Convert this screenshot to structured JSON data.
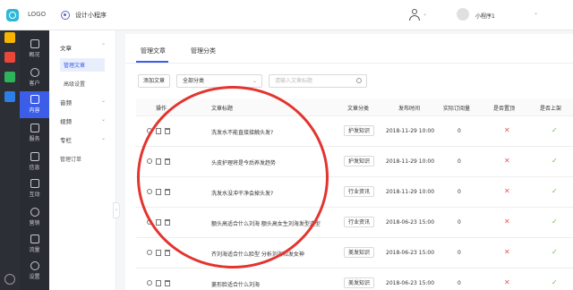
{
  "header": {
    "logo": "LOGO",
    "app_name": "设计小程序",
    "account_name": "小程序1"
  },
  "nav": {
    "items": [
      {
        "label": "概况"
      },
      {
        "label": "客户"
      },
      {
        "label": "内容",
        "active": true
      },
      {
        "label": "服务"
      },
      {
        "label": "信息"
      },
      {
        "label": "互动"
      },
      {
        "label": "营销"
      },
      {
        "label": "流量"
      },
      {
        "label": "设置"
      }
    ]
  },
  "submenu": {
    "group_article": "文章",
    "item_manage": "管理文章",
    "item_advanced": "高级设置",
    "group_audio": "音频",
    "group_video": "视频",
    "group_column": "专栏",
    "item_orders": "管理订单"
  },
  "tabs": [
    "管理文章",
    "管理分类"
  ],
  "toolbar": {
    "add_label": "添加文章",
    "category_value": "全部分类",
    "search_placeholder": "请输入文章标题"
  },
  "table": {
    "columns": [
      "操作",
      "文章标题",
      "文章分类",
      "发布时间",
      "实际订阅量",
      "是否置顶",
      "是否上架"
    ],
    "rows": [
      {
        "title": "洗发水不能直接接触头发?",
        "category": "护发知识",
        "date": "2018-11-29 10:00",
        "subs": "0",
        "pinned": false,
        "listed": true
      },
      {
        "title": "头皮护理将是今后养发趋势",
        "category": "护发知识",
        "date": "2018-11-29 10:00",
        "subs": "0",
        "pinned": false,
        "listed": true
      },
      {
        "title": "洗发水没冲干净会掉头发?",
        "category": "行业资讯",
        "date": "2018-11-29 10:00",
        "subs": "0",
        "pinned": false,
        "listed": true
      },
      {
        "title": "额头高适合什么刘海 额头高女生刘海发型造型",
        "category": "行业资讯",
        "date": "2018-06-23 15:00",
        "subs": "0",
        "pinned": false,
        "listed": true
      },
      {
        "title": "齐刘海适合什么脸型 分析刘海和发女神",
        "category": "美发知识",
        "date": "2018-06-23 15:00",
        "subs": "0",
        "pinned": false,
        "listed": true
      },
      {
        "title": "菱形脸适合什么刘海",
        "category": "美发知识",
        "date": "2018-06-23 15:00",
        "subs": "0",
        "pinned": false,
        "listed": true
      }
    ]
  },
  "colors": {
    "accent": "#3b5de7",
    "annotation": "#e3342f",
    "cross": "#e05a5a",
    "check": "#6abf4b"
  }
}
